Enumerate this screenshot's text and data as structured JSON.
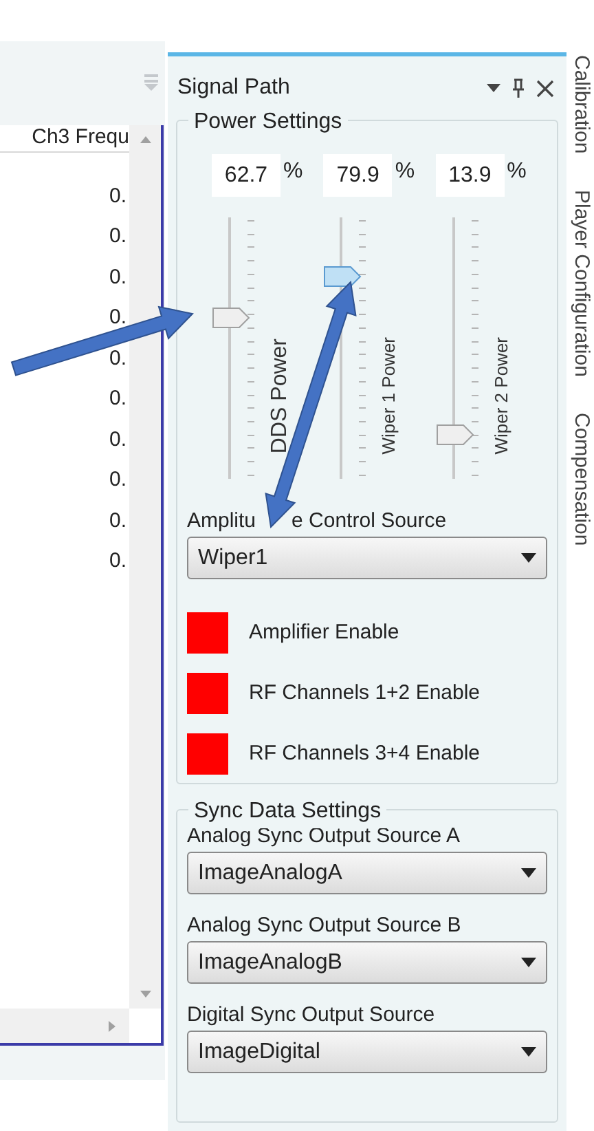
{
  "grid": {
    "header": "Ch3 Frequ",
    "rows": [
      "0.",
      "0.",
      "0.",
      "0.",
      "0.",
      "0.",
      "0.",
      "0.",
      "0.",
      "0."
    ]
  },
  "panel": {
    "title": "Signal Path"
  },
  "side_tabs": [
    "Calibration",
    "Player Configuration",
    "Compensation"
  ],
  "power_settings": {
    "title": "Power Settings",
    "sliders": [
      {
        "value": "62.7",
        "unit": "%",
        "label": "DDS Power",
        "level": 0.627,
        "selected": false
      },
      {
        "value": "79.9",
        "unit": "%",
        "label": "Wiper 1 Power",
        "level": 0.799,
        "selected": true
      },
      {
        "value": "13.9",
        "unit": "%",
        "label": "Wiper 2 Power",
        "level": 0.139,
        "selected": false
      }
    ],
    "amplitude_source": {
      "label_parts": [
        "Amplitu",
        "e Control Source"
      ],
      "value": "Wiper1"
    },
    "enables": [
      {
        "label": "Amplifier Enable",
        "on": false
      },
      {
        "label": "RF Channels 1+2 Enable",
        "on": false
      },
      {
        "label": "RF Channels 3+4 Enable",
        "on": false
      }
    ]
  },
  "sync_data_settings": {
    "title": "Sync Data Settings",
    "fields": [
      {
        "label": "Analog Sync Output Source A",
        "value": "ImageAnalogA"
      },
      {
        "label": "Analog Sync Output Source B",
        "value": "ImageAnalogB"
      },
      {
        "label": "Digital Sync Output Source",
        "value": "ImageDigital"
      }
    ]
  }
}
